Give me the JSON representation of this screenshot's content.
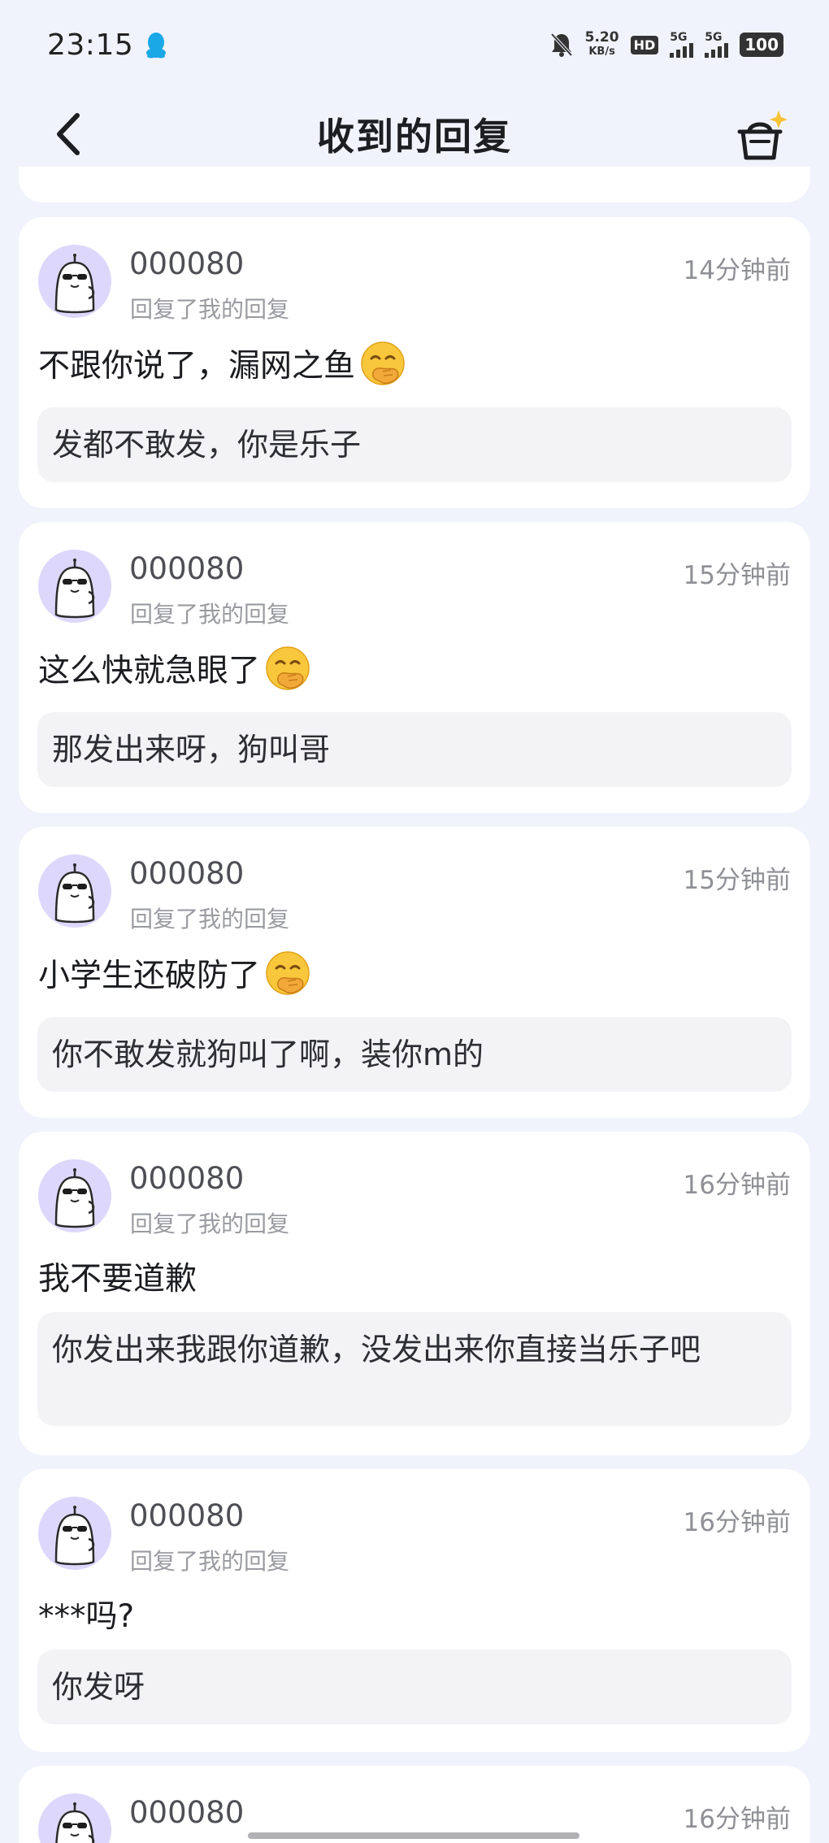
{
  "status_bar": {
    "time": "23:15",
    "speed_value": "5.20",
    "speed_unit": "KB/s",
    "hd_label": "HD",
    "signal_1": "5G",
    "signal_2": "5G",
    "battery": "100"
  },
  "header": {
    "title": "收到的回复"
  },
  "replies": [
    {
      "username": "000080",
      "action": "回复了我的回复",
      "time": "14分钟前",
      "text": "不跟你说了，漏网之鱼",
      "has_emoji": true,
      "quote": "发都不敢发，你是乐子"
    },
    {
      "username": "000080",
      "action": "回复了我的回复",
      "time": "15分钟前",
      "text": "这么快就急眼了",
      "has_emoji": true,
      "quote": "那发出来呀，狗叫哥"
    },
    {
      "username": "000080",
      "action": "回复了我的回复",
      "time": "15分钟前",
      "text": "小学生还破防了",
      "has_emoji": true,
      "quote": "你不敢发就狗叫了啊，装你m的"
    },
    {
      "username": "000080",
      "action": "回复了我的回复",
      "time": "16分钟前",
      "text": "我不要道歉",
      "has_emoji": false,
      "quote": "你发出来我跟你道歉，没发出来你直接当乐子吧"
    },
    {
      "username": "000080",
      "action": "回复了我的回复",
      "time": "16分钟前",
      "text": "***吗?",
      "has_emoji": false,
      "quote": "你发呀"
    },
    {
      "username": "000080",
      "action": "",
      "time": "16分钟前",
      "text": "",
      "has_emoji": false,
      "quote": ""
    }
  ],
  "colors": {
    "background": "#f1f3fc",
    "card": "#ffffff",
    "quote_bg": "#f3f3f6",
    "avatar_bg": "#ddd8fb",
    "qq_icon": "#1aa8e6"
  },
  "icons": [
    "back-arrow-icon",
    "basket-sparkle-icon",
    "qq-penguin-icon",
    "bell-muted-icon",
    "face-hand-over-mouth-emoji"
  ]
}
